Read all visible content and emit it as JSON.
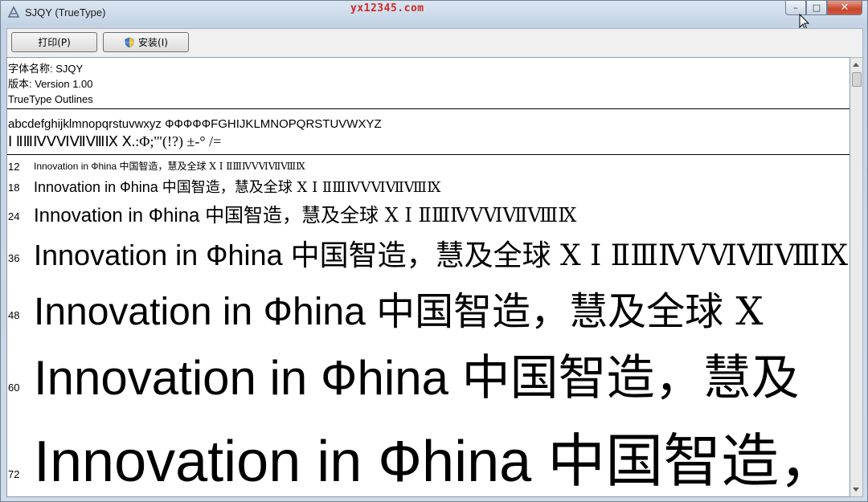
{
  "window": {
    "title": "SJQY (TrueType)",
    "watermark": "yx12345.com",
    "buttons": {
      "minimize": "–",
      "restore": "□",
      "close": "✕"
    }
  },
  "toolbar": {
    "print_label": "打印(P)",
    "install_label": "安装(I)"
  },
  "font_info": {
    "name_line": "字体名称: SJQY",
    "version_line": "版本: Version 1.00",
    "outline_line": "TrueType Outlines"
  },
  "charset": {
    "line1": "abcdefghijklmnopqrstuvwxyz ФФФФФFGHIJKLMNOPQRSTUVWXYZ",
    "line2": "Ⅰ ⅡⅢⅣⅤⅥⅦⅧⅨ Ⅹ.:Φ;'\"(!?) ±-° /="
  },
  "samples": [
    {
      "size": "12",
      "latin": "Innovation in Фhina ",
      "cjk": "中国智造，慧及全球 ",
      "roman": "Ⅹ Ⅰ ⅡⅢⅣⅤⅥⅦⅧⅨ"
    },
    {
      "size": "18",
      "latin": "Innovation in Фhina ",
      "cjk": "中国智造，慧及全球 ",
      "roman": "Ⅹ Ⅰ ⅡⅢⅣⅤⅥⅦⅧⅨ"
    },
    {
      "size": "24",
      "latin": "Innovation in Фhina ",
      "cjk": "中国智造，慧及全球 ",
      "roman": "Ⅹ Ⅰ ⅡⅢⅣⅤⅥⅦⅧⅨ"
    },
    {
      "size": "36",
      "latin": "Innovation in Фhina ",
      "cjk": "中国智造，慧及全球 ",
      "roman": "Ⅹ Ⅰ ⅡⅢⅣⅤⅥⅦⅧⅨ"
    },
    {
      "size": "48",
      "latin": "Innovation in Фhina ",
      "cjk": "中国智造，慧及全球 ",
      "roman": "Ⅹ"
    },
    {
      "size": "60",
      "latin": "Innovation in Фhina ",
      "cjk": "中国智造，慧及",
      "roman": ""
    },
    {
      "size": "72",
      "latin": "Innovation in Фhina ",
      "cjk": "中国智造，",
      "roman": ""
    }
  ],
  "icons": {
    "app": "font-viewer-icon",
    "install": "uac-shield-icon"
  }
}
